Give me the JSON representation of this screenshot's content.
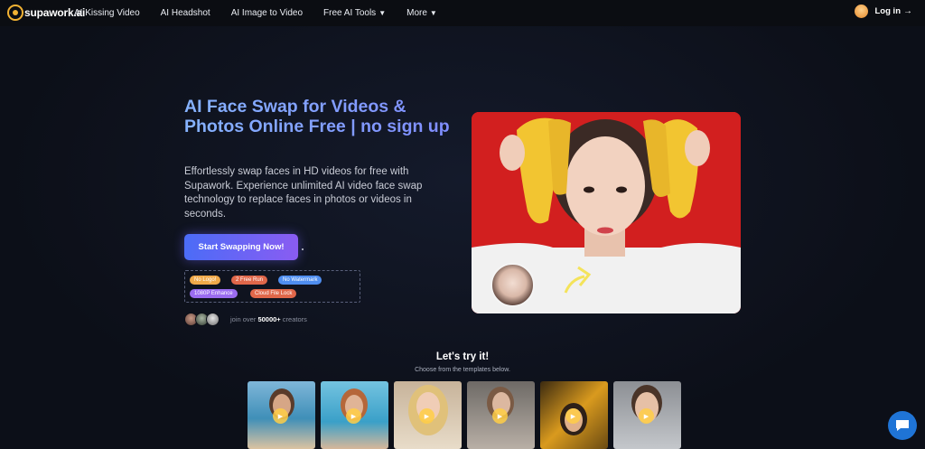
{
  "nav": {
    "logo_text": "supawork.ai",
    "links": [
      {
        "label": "AI Kissing Video"
      },
      {
        "label": "AI Headshot"
      },
      {
        "label": "AI Image to Video"
      },
      {
        "label": "Free AI Tools"
      },
      {
        "label": "More"
      }
    ],
    "login_label": "Log in",
    "login_arrow": "→"
  },
  "hero": {
    "title": "AI Face Swap for Videos & Photos Online Free | no sign up",
    "description": "Effortlessly swap faces in HD videos for free with Supawork. Experience unlimited AI video face swap technology to replace faces in photos or videos in seconds.",
    "cta_label": "Start Swapping Now!",
    "tags": [
      {
        "label": "No Logo!",
        "color": "#f0a94a"
      },
      {
        "label": "2 Free Run",
        "color": "#e0674a"
      },
      {
        "label": "No Watermark",
        "color": "#4f8ef0"
      },
      {
        "label": "1080P Enhance",
        "color": "#9b6cf0"
      },
      {
        "label": "Cloud File Lock",
        "color": "#e0674a"
      }
    ],
    "creators_prefix": "join over",
    "creators_count": "50000+",
    "creators_suffix": "creators"
  },
  "templates": {
    "title": "Let's try it!",
    "subtitle": "Choose from the templates below.",
    "play_icon": "▶"
  },
  "colors": {
    "accent": "#4b6cf7",
    "chat": "#1f74d6",
    "hero_bg": "#d21f1f"
  }
}
